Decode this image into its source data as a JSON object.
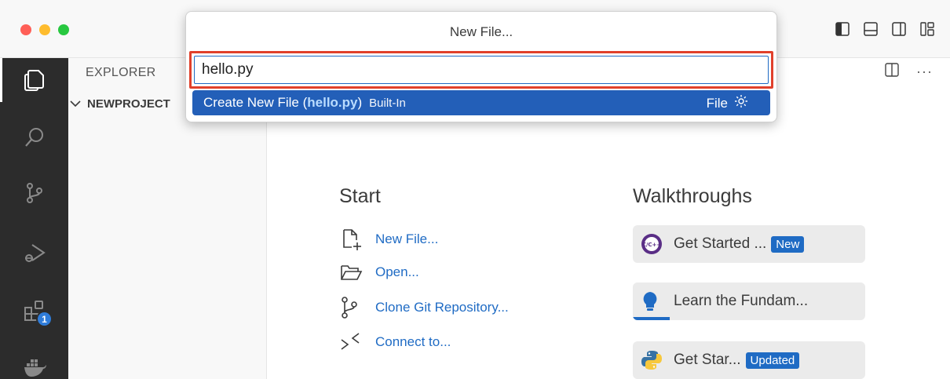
{
  "titlebar": {
    "layout_icons": [
      "toggle-primary-sidebar-icon",
      "toggle-panel-icon",
      "toggle-secondary-sidebar-icon",
      "customize-layout-icon"
    ]
  },
  "activitybar": {
    "items": [
      "explorer-icon",
      "search-icon",
      "source-control-icon",
      "run-debug-icon",
      "extensions-icon",
      "docker-icon"
    ],
    "extensions_badge": "1"
  },
  "sidebar": {
    "title": "EXPLORER",
    "section": "NEWPROJECT"
  },
  "quick_input": {
    "title": "New File...",
    "value": "hello.py",
    "option": {
      "label_prefix": "Create New File (",
      "label_highlight": "hello.py",
      "label_suffix": ")",
      "description": "Built-In",
      "category": "File"
    }
  },
  "welcome": {
    "start_heading": "Start",
    "start_items": {
      "new_file": "New File...",
      "open": "Open...",
      "clone": "Clone Git Repository...",
      "connect": "Connect to..."
    },
    "walkthroughs_heading": "Walkthroughs",
    "walkthroughs": {
      "cpp": {
        "label": "Get Started ...",
        "tag": "New"
      },
      "fundamentals": {
        "label": "Learn the Fundam...",
        "progress": 0.16
      },
      "python": {
        "label": "Get Star...",
        "tag": "Updated"
      }
    }
  },
  "colors": {
    "accent": "#1f6bc4",
    "selection": "#235fb8",
    "highlight_box": "#e0402b",
    "activitybar": "#2c2c2c"
  }
}
